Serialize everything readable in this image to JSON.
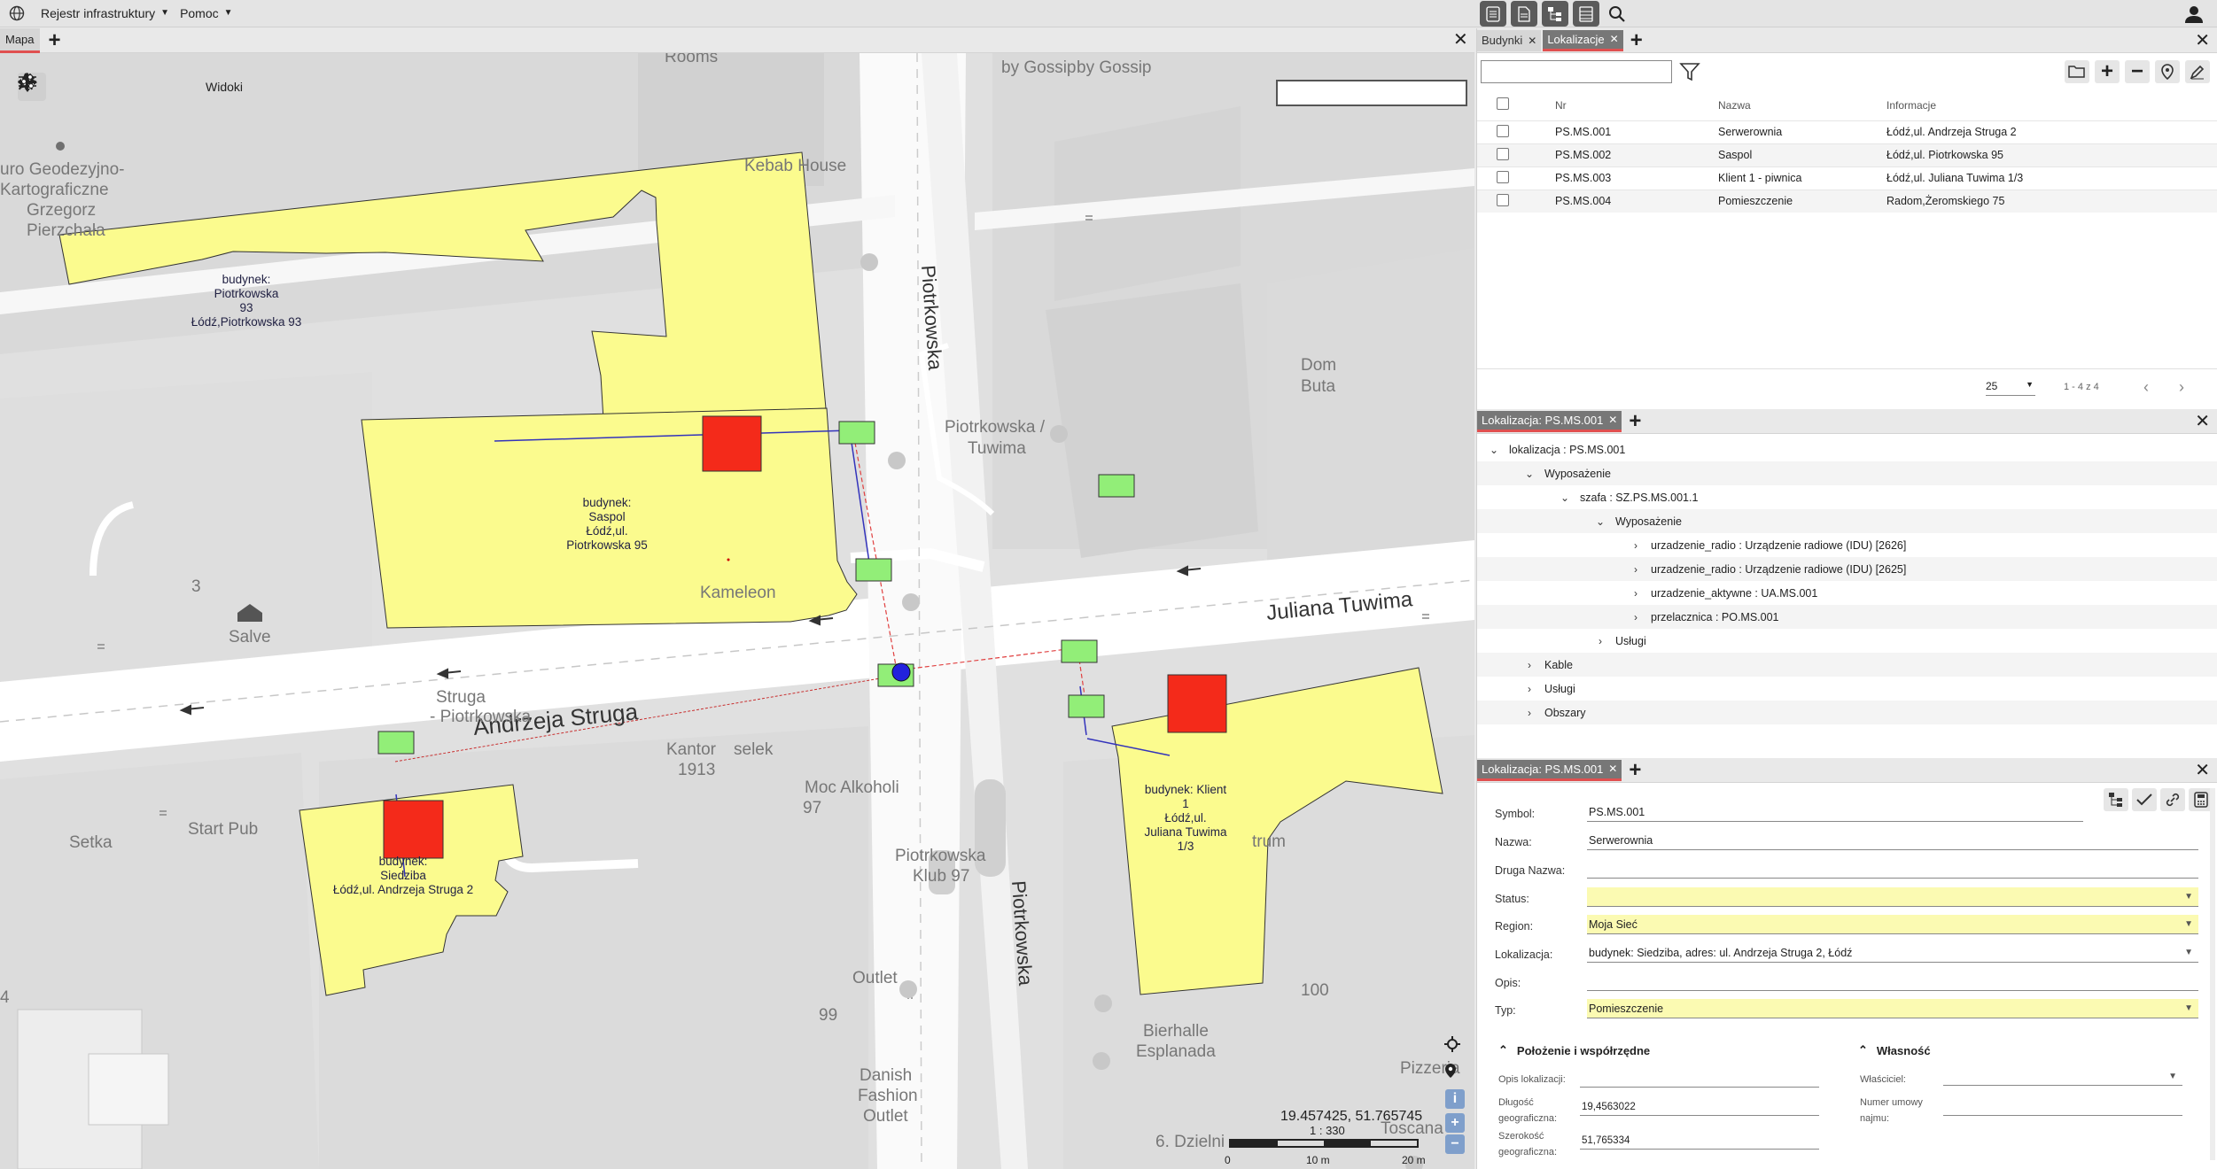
{
  "menubar": {
    "items": [
      {
        "label": "Rejestr infrastruktury"
      },
      {
        "label": "Pomoc"
      }
    ]
  },
  "map_tabs": {
    "active": "Mapa"
  },
  "map": {
    "toolbar": {
      "views_label": "Widoki"
    },
    "coords": "19.457425, 51.765745",
    "scale": "1 : 330",
    "scale_ticks": [
      "0",
      "10 m",
      "20 m"
    ],
    "street_labels": {
      "andrzeja_struga": "Andrzeja Struga",
      "juliana_tuwima": "Juliana Tuwima",
      "piotrkowska_north": "Piotrkowska",
      "piotrkowska_south": "Piotrkowska"
    },
    "poi_labels": [
      "Rooms",
      "Kebab House",
      "by Gossip",
      "by Gossip",
      "uro Geodezyjno-",
      "Kartograficzne",
      "Grzegorz",
      "Pierzchała",
      "Dom",
      "Buta",
      "Piotrkowska /",
      "Tuwima",
      "3",
      "Salve",
      "Kameleon",
      "Struga",
      "- Piotrkowska",
      "Kantor",
      "1913",
      "selek",
      "Moc Alkoholi",
      "97",
      "Setka",
      "Start Pub",
      "Piotrkowska",
      "Klub 97",
      "Outlet",
      "99",
      "Danish",
      "Fashion",
      "Outlet",
      "trum",
      "100",
      "Bierhalle",
      "Esplanada",
      "6. Dzielni",
      "Toscana",
      "Pizzeria",
      "4"
    ],
    "buildings": [
      {
        "label": [
          "budynek:",
          "Piotrkowska",
          "93",
          "Łódź,Piotrkowska 93"
        ]
      },
      {
        "label": [
          "budynek:",
          "Saspol",
          "Łódź,ul.",
          "Piotrkowska 95"
        ]
      },
      {
        "label": [
          "budynek:",
          "Siedziba",
          "Łódź,ul. Andrzeja Struga 2"
        ]
      },
      {
        "label": [
          "budynek: Klient",
          "1",
          "Łódź,ul.",
          "Juliana Tuwima",
          "1/3"
        ]
      }
    ]
  },
  "right_toolbar": {
    "icons": [
      "list-icon",
      "document-icon",
      "tree-icon",
      "table-icon",
      "search-icon"
    ]
  },
  "panel1": {
    "tabs": [
      {
        "label": "Budynki"
      },
      {
        "label": "Lokalizacje"
      }
    ],
    "columns": [
      "Nr",
      "Nazwa",
      "Informacje"
    ],
    "rows": [
      {
        "nr": "PS.MS.001",
        "nazwa": "Serwerownia",
        "info": "Łódź,ul. Andrzeja Struga 2"
      },
      {
        "nr": "PS.MS.002",
        "nazwa": "Saspol",
        "info": "Łódź,ul. Piotrkowska 95"
      },
      {
        "nr": "PS.MS.003",
        "nazwa": "Klient 1 - piwnica",
        "info": "Łódź,ul. Juliana Tuwima 1/3"
      },
      {
        "nr": "PS.MS.004",
        "nazwa": "Pomieszczenie",
        "info": "Radom,Żeromskiego 75"
      }
    ],
    "page_size": "25",
    "page_info": "1 - 4 z 4"
  },
  "panel2": {
    "tab": "Lokalizacja: PS.MS.001",
    "tree": [
      {
        "label": "lokalizacja : PS.MS.001",
        "chev": "down"
      },
      {
        "label": "Wyposażenie",
        "chev": "down"
      },
      {
        "label": "szafa : SZ.PS.MS.001.1",
        "chev": "down"
      },
      {
        "label": "Wyposażenie",
        "chev": "down"
      },
      {
        "label": "urzadzenie_radio : Urządzenie radiowe (IDU) [2626]",
        "chev": "right"
      },
      {
        "label": "urzadzenie_radio : Urządzenie radiowe (IDU) [2625]",
        "chev": "right"
      },
      {
        "label": "urzadzenie_aktywne : UA.MS.001",
        "chev": "right"
      },
      {
        "label": "przelacznica : PO.MS.001",
        "chev": "right"
      },
      {
        "label": "Usługi",
        "chev": "right"
      },
      {
        "label": "Kable",
        "chev": "right"
      },
      {
        "label": "Usługi",
        "chev": "right"
      },
      {
        "label": "Obszary",
        "chev": "right"
      }
    ]
  },
  "panel3": {
    "tab": "Lokalizacja: PS.MS.001",
    "fields": {
      "symbol": {
        "label": "Symbol:",
        "value": "PS.MS.001"
      },
      "nazwa": {
        "label": "Nazwa:",
        "value": "Serwerownia"
      },
      "druga_nazwa": {
        "label": "Druga Nazwa:",
        "value": ""
      },
      "status": {
        "label": "Status:",
        "value": ""
      },
      "region": {
        "label": "Region:",
        "value": "Moja Sieć"
      },
      "lokalizacja": {
        "label": "Lokalizacja:",
        "value": "budynek: Siedziba, adres: ul. Andrzeja Struga 2, Łódź"
      },
      "opis": {
        "label": "Opis:",
        "value": ""
      },
      "typ": {
        "label": "Typ:",
        "value": "Pomieszczenie"
      }
    },
    "section_position": {
      "title": "Położenie i współrzędne",
      "opis_label": "Opis lokalizacji:",
      "dlugosc_label_1": "Długość",
      "dlugosc_label_2": "geograficzna:",
      "dlugosc_value": "19,4563022",
      "szerokosc_label_1": "Szerokość",
      "szerokosc_label_2": "geograficzna:",
      "szerokosc_value": "51,765334"
    },
    "section_ownership": {
      "title": "Własność",
      "owner_label": "Właściciel:",
      "contract_label_1": "Numer umowy",
      "contract_label_2": "najmu:"
    }
  },
  "colors": {
    "building_fill": "#fbfb8e",
    "device_red": "#f42a1a",
    "connector_green": "#92ee78",
    "node_blue": "#2222dd",
    "active_tab_accent": "#e05050",
    "highlight_yellow": "#fbfab2"
  }
}
